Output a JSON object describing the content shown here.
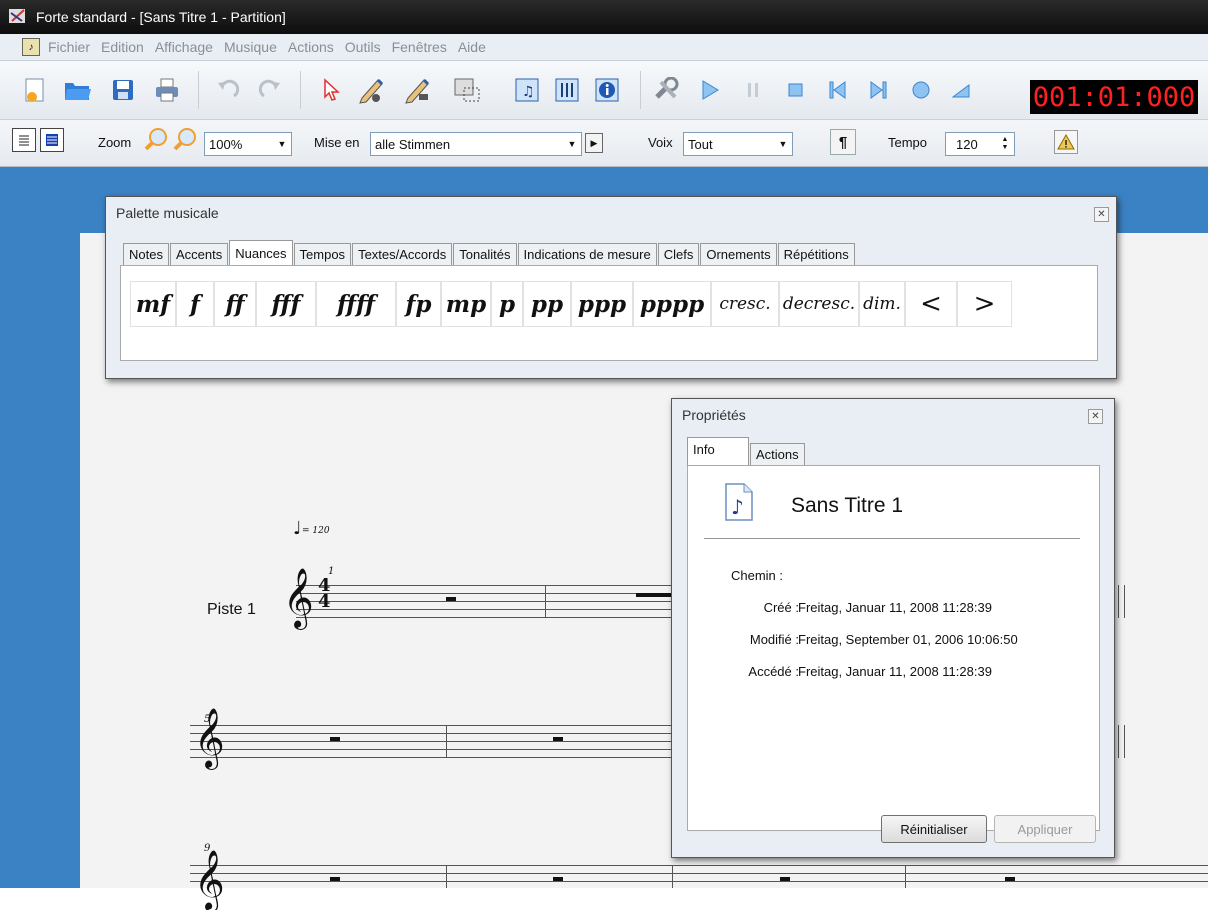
{
  "window": {
    "title": "Forte standard - [Sans Titre 1 - Partition]"
  },
  "menu": [
    "Fichier",
    "Edition",
    "Affichage",
    "Musique",
    "Actions",
    "Outils",
    "Fenêtres",
    "Aide"
  ],
  "counter": "001:01:000",
  "toolbar2": {
    "zoom_label": "Zoom",
    "zoom_value": "100%",
    "mise_en_label": "Mise en",
    "mise_en_value": "alle Stimmen",
    "voix_label": "Voix",
    "voix_value": "Tout",
    "pilcrow": "¶",
    "tempo_label": "Tempo",
    "tempo_value": "120"
  },
  "palette": {
    "title": "Palette musicale",
    "tabs": [
      "Notes",
      "Accents",
      "Nuances",
      "Tempos",
      "Textes/Accords",
      "Tonalités",
      "Indications de mesure",
      "Clefs",
      "Ornements",
      "Répétitions"
    ],
    "active_tab": "Nuances",
    "dynamics": [
      "mf",
      "f",
      "ff",
      "fff",
      "ffff",
      "fp",
      "mp",
      "p",
      "pp",
      "ppp",
      "pppp",
      "cresc.",
      "decresc.",
      "dim.",
      "<",
      ">"
    ]
  },
  "score": {
    "tempo_mark": "= 120",
    "track_name": "Piste 1",
    "time_signature": "4/4",
    "measure_numbers": [
      "1",
      "5",
      "9"
    ]
  },
  "properties": {
    "title": "Propriétés",
    "tabs": [
      "Info",
      "Actions"
    ],
    "active_tab": "Info",
    "doc_name": "Sans Titre 1",
    "fields": [
      {
        "label": "Chemin :",
        "value": ""
      },
      {
        "label": "Créé :",
        "value": "Freitag, Januar 11, 2008 11:28:39"
      },
      {
        "label": "Modifié :",
        "value": "Freitag, September 01, 2006 10:06:50"
      },
      {
        "label": "Accédé :",
        "value": "Freitag, Januar 11, 2008 11:28:39"
      }
    ],
    "reset_label": "Réinitialiser",
    "apply_label": "Appliquer"
  }
}
